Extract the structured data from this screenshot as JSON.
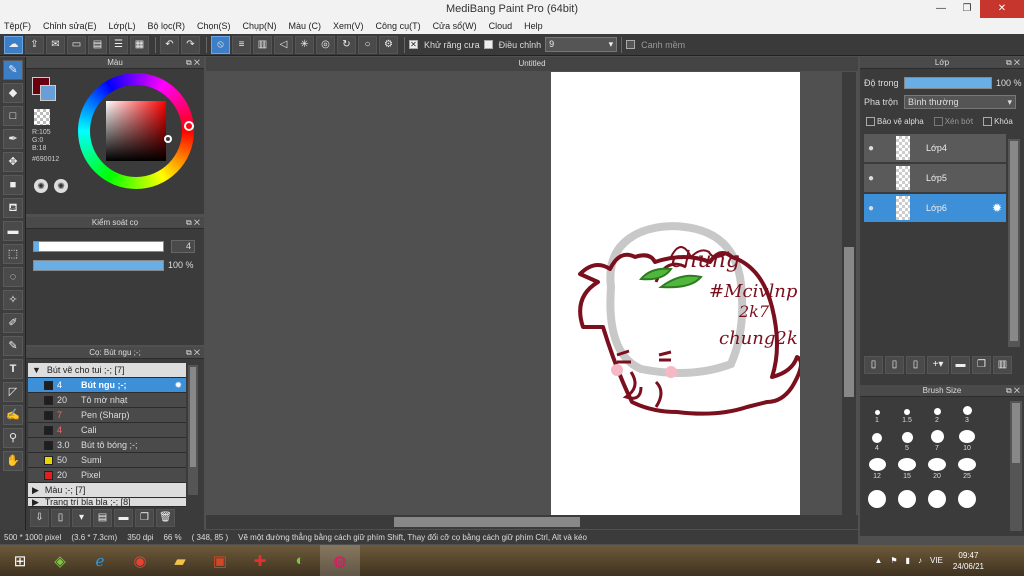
{
  "window": {
    "title": "MediBang Paint Pro (64bit)"
  },
  "menu": [
    "Tệp(F)",
    "Chỉnh sửa(E)",
    "Lớp(L)",
    "Bộ lọc(R)",
    "Chọn(S)",
    "Chụp(N)",
    "Màu (C)",
    "Xem(V)",
    "Công cụ(T)",
    "Cửa sổ(W)",
    "Cloud",
    "Help"
  ],
  "toolbar": {
    "antialias_label": "Khử răng cưa",
    "adjust_label": "Điều chỉnh",
    "adjust_value": "9",
    "snap_label": "Canh mềm"
  },
  "color_panel": {
    "title": "Màu",
    "r": "R:105",
    "g": "G:0",
    "b": "B:18",
    "hex": "#690012",
    "primary_color": "#690012",
    "secondary_color": "#6a9ed6"
  },
  "brush_control": {
    "title": "Kiểm soát cọ",
    "size_value": "4",
    "opacity_value": "100 %",
    "opacity_fraction": 1.0,
    "size_fraction": 0.04
  },
  "brush_panel": {
    "title": "Cọ: Bút ngu ;-;",
    "group1": "Bút vẽ cho tui ;-; [7]",
    "group2": "Màu ;-; [7]",
    "group3": "Trang trí bla bla ;-; [8]",
    "items": [
      {
        "size": "4",
        "name": "Bút ngu ;-;",
        "color": "#1e1e1e",
        "selected": true
      },
      {
        "size": "20",
        "name": "Tô mờ nhạt",
        "color": "#1e1e1e"
      },
      {
        "size": "7",
        "name": "Pen (Sharp)",
        "color": "#1e1e1e"
      },
      {
        "size": "4",
        "name": "Cali",
        "color": "#1e1e1e"
      },
      {
        "size": "3.0",
        "name": "Bút tô bóng ;-;",
        "color": "#1e1e1e"
      },
      {
        "size": "50",
        "name": "Sumi",
        "color": "#e8d600"
      },
      {
        "size": "20",
        "name": "Pixel",
        "color": "#e02020"
      }
    ]
  },
  "canvas": {
    "tab_title": "Untitled",
    "drawing_text1": "chung",
    "drawing_text2": "#Mcivlnp",
    "drawing_text3": "2k7",
    "drawing_text4": "chung2k7"
  },
  "layer_panel": {
    "title": "Lớp",
    "opacity_label": "Độ trong",
    "opacity_value": "100 %",
    "opacity_fraction": 1.0,
    "blend_label": "Pha trộn",
    "blend_value": "Bình thường",
    "protect_alpha": "Bảo vệ alpha",
    "clip": "Xén bớt",
    "lock": "Khóa",
    "layers": [
      {
        "name": "Lớp4"
      },
      {
        "name": "Lớp5"
      },
      {
        "name": "Lớp6",
        "selected": true
      }
    ]
  },
  "brush_size_panel": {
    "title": "Brush Size",
    "sizes": [
      "1",
      "1.5",
      "2",
      "3",
      "4",
      "5",
      "7",
      "10",
      "12",
      "15",
      "20",
      "25"
    ]
  },
  "status": {
    "dims": "500 * 1000 pixel",
    "cm": "(3.6 * 7.3cm)",
    "dpi": "350 dpi",
    "zoom": "66 %",
    "coords": "( 348, 85 )",
    "hint": "Vẽ một đường thẳng bằng cách giữ phím Shift, Thay đổi cỡ cọ bằng cách giữ phím Ctrl, Alt và kéo"
  },
  "taskbar": {
    "lang": "VIE",
    "time": "09:47",
    "date": "24/06/21"
  }
}
